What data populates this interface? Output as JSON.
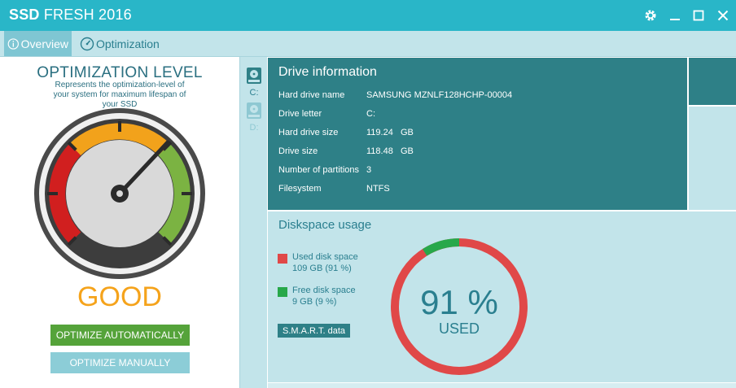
{
  "app": {
    "title_bold": "SSD",
    "title_rest": " FRESH 2016"
  },
  "tabs": [
    {
      "label": "Overview",
      "icon": "info-icon",
      "active": true
    },
    {
      "label": "Optimization",
      "icon": "speedometer-icon",
      "active": false
    }
  ],
  "optimization": {
    "title": "OPTIMIZATION LEVEL",
    "subtitle": "Represents the optimization-level of your system for maximum lifespan of your SSD",
    "status": "GOOD",
    "btn_auto": "OPTIMIZE AUTOMATICALLY",
    "btn_manual": "OPTIMIZE MANUALLY"
  },
  "drives": [
    {
      "label": "C:",
      "selected": true
    },
    {
      "label": "D:",
      "selected": false
    }
  ],
  "drive_info": {
    "heading": "Drive information",
    "rows": [
      {
        "key": "Hard drive name",
        "value": "SAMSUNG MZNLF128HCHP-00004"
      },
      {
        "key": "Drive letter",
        "value": "C:"
      },
      {
        "key": "Hard drive size",
        "value": "119.24   GB"
      },
      {
        "key": "Drive size",
        "value": "118.48   GB"
      },
      {
        "key": "Number of partitions",
        "value": "3"
      },
      {
        "key": "Filesystem",
        "value": "NTFS"
      }
    ]
  },
  "diskspace": {
    "heading": "Diskspace usage",
    "used_label": "Used disk space",
    "used_value": "109 GB (91 %)",
    "free_label": "Free disk space",
    "free_value": "9 GB (9 %)",
    "smart_label": "S.M.A.R.T. data",
    "percent": "91 %",
    "percent_caption": "USED",
    "used_fraction": 0.91
  },
  "colors": {
    "accent": "#29b6c8",
    "teal_dark": "#2e8087",
    "used": "#e04848",
    "free": "#27a84a",
    "good": "#f5a31b"
  }
}
